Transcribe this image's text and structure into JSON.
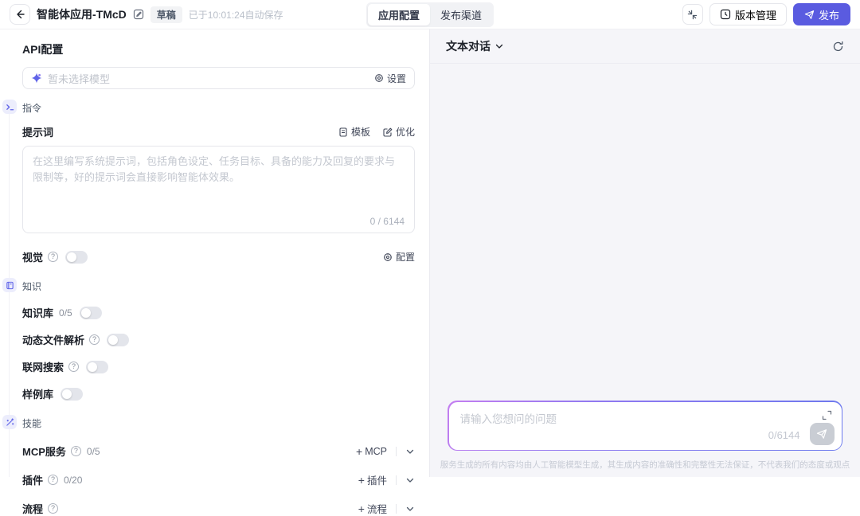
{
  "icons": {
    "help": "?",
    "plus": "+"
  },
  "topbar": {
    "title": "智能体应用-TMcD",
    "draft_badge": "草稿",
    "autosave_text": "已于10:01:24自动保存",
    "tabs": [
      {
        "label": "应用配置"
      },
      {
        "label": "发布渠道"
      }
    ],
    "version_button": "版本管理",
    "publish_button": "发布"
  },
  "api_config": {
    "title": "API配置",
    "model_selector": {
      "placeholder": "暂未选择模型",
      "settings_label": "设置"
    },
    "instruction_section": {
      "label": "指令",
      "prompt_label": "提示词",
      "template_button": "模板",
      "optimize_button": "优化",
      "prompt_placeholder": "在这里编写系统提示词，包括角色设定、任务目标、具备的能力及回复的要求与限制等，好的提示词会直接影响智能体效果。",
      "prompt_counter": "0 / 6144",
      "vision_label": "视觉",
      "vision_config_label": "配置"
    },
    "knowledge_section": {
      "label": "知识",
      "rows": [
        {
          "label": "知识库",
          "count": "0/5"
        },
        {
          "label": "动态文件解析"
        },
        {
          "label": "联网搜索"
        },
        {
          "label": "样例库"
        }
      ]
    },
    "skills_section": {
      "label": "技能",
      "rows": [
        {
          "label": "MCP服务",
          "count": "0/5",
          "add_label": "MCP"
        },
        {
          "label": "插件",
          "count": "0/20",
          "add_label": "插件"
        },
        {
          "label": "流程",
          "add_label": "流程"
        }
      ]
    }
  },
  "chat_panel": {
    "mode_label": "文本对话",
    "input_placeholder": "请输入您想问的问题",
    "counter": "0/6144",
    "disclaimer": "服务生成的所有内容均由人工智能模型生成，其生成内容的准确性和完整性无法保证，不代表我们的态度或观点"
  },
  "colors": {
    "accent": "#5a5be0",
    "accent_light": "#ecedfc",
    "panel_bg": "#f5f5f9"
  }
}
